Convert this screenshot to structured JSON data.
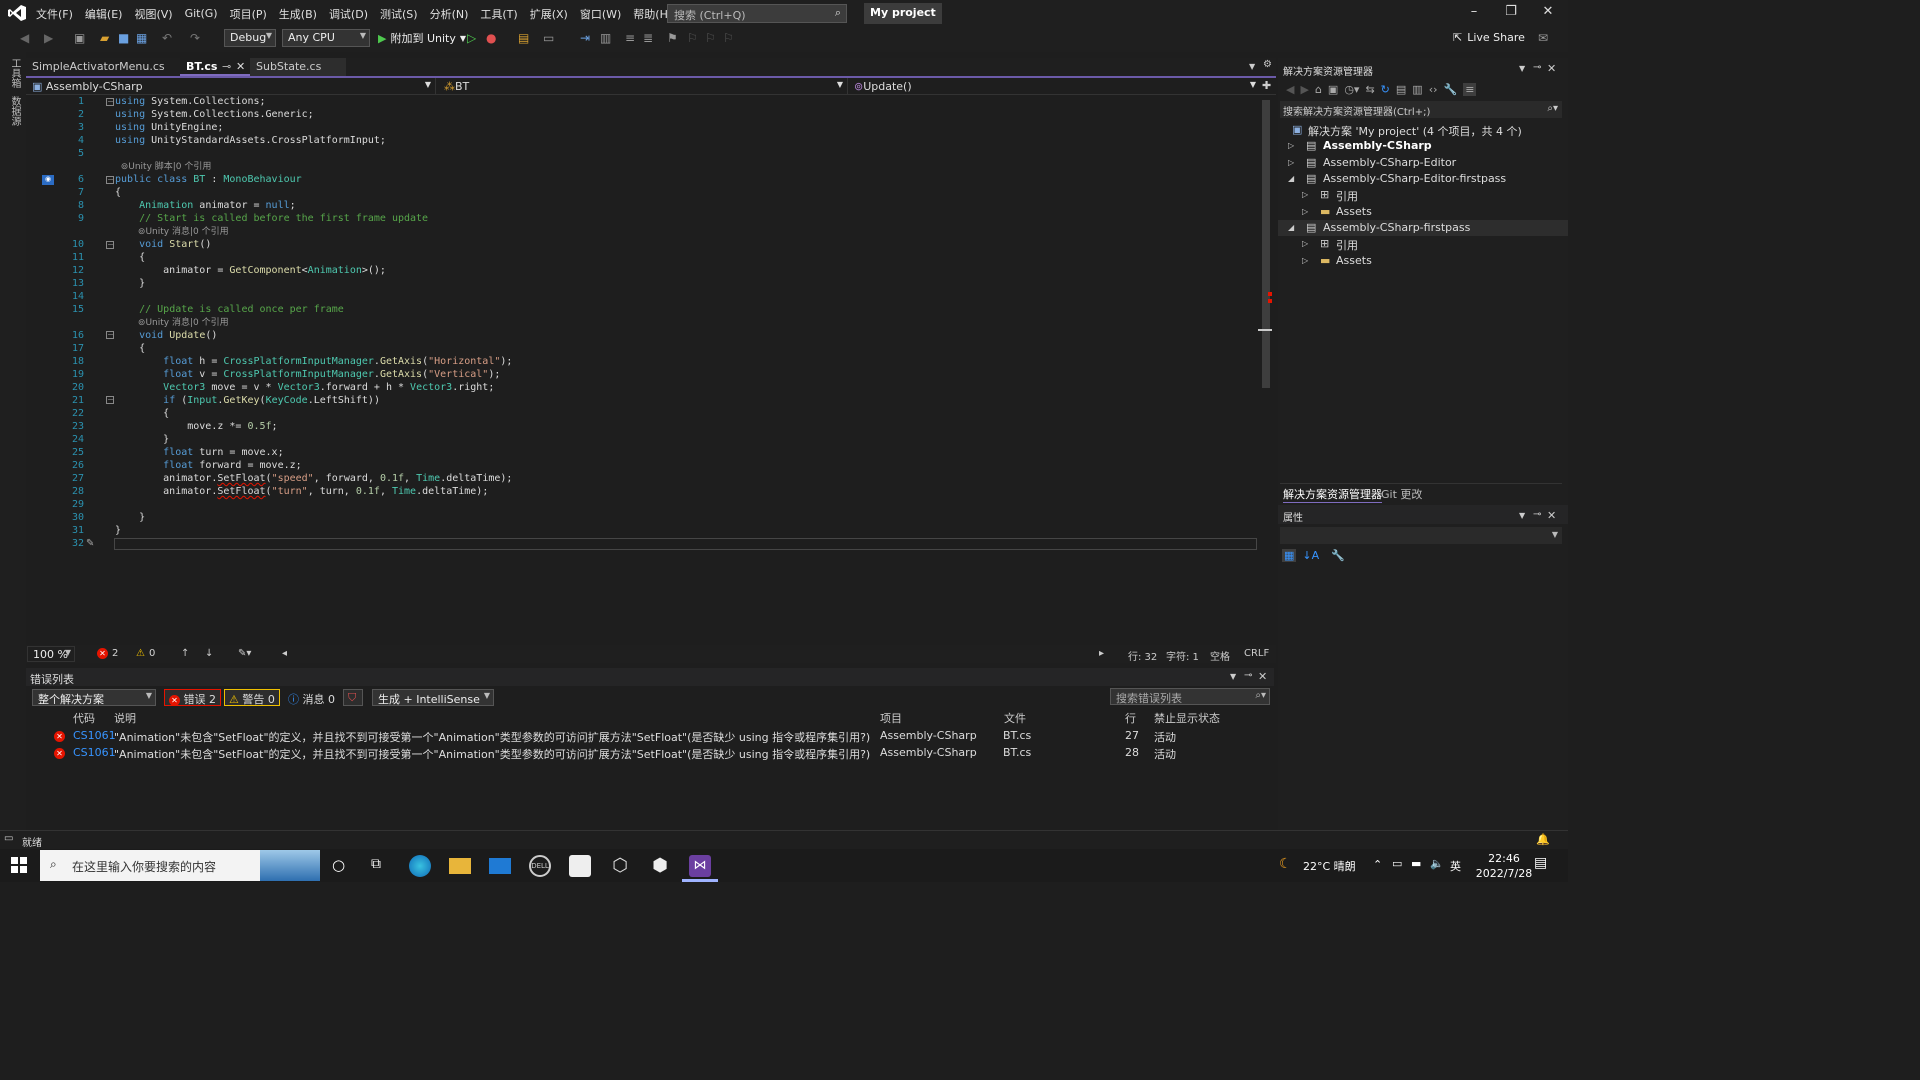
{
  "title_bar": {
    "menu": [
      "文件(F)",
      "编辑(E)",
      "视图(V)",
      "Git(G)",
      "项目(P)",
      "生成(B)",
      "调试(D)",
      "测试(S)",
      "分析(N)",
      "工具(T)",
      "扩展(X)",
      "窗口(W)",
      "帮助(H)"
    ],
    "search_placeholder": "搜索 (Ctrl+Q)",
    "project_name": "My project"
  },
  "toolbar": {
    "config": "Debug",
    "platform": "Any CPU",
    "attach_label": "附加到 Unity",
    "live_share": "Live Share"
  },
  "left_strip": {
    "label1": "工具箱",
    "label2": "数据源"
  },
  "tabs": [
    {
      "label": "SimpleActivatorMenu.cs"
    },
    {
      "label": "BT.cs"
    },
    {
      "label": "SubState.cs"
    }
  ],
  "nav": {
    "project": "Assembly-CSharp",
    "type": "BT",
    "member": "Update()"
  },
  "editor": {
    "line_numbers": [
      "1",
      "2",
      "3",
      "4",
      "5",
      "6",
      "7",
      "8",
      "9",
      "10",
      "11",
      "12",
      "13",
      "14",
      "15",
      "16",
      "17",
      "18",
      "19",
      "20",
      "21",
      "22",
      "23",
      "24",
      "25",
      "26",
      "27",
      "28",
      "29",
      "30",
      "31",
      "32"
    ],
    "hint_unity_script": "Unity 脚本|0 个引用",
    "hint_unity_msg": "Unity 消息|0 个引用"
  },
  "editor_status": {
    "zoom": "100 %",
    "errors": "2",
    "warnings": "0",
    "line": "行: 32",
    "char": "字符: 1",
    "space": "空格",
    "eol": "CRLF"
  },
  "error_list": {
    "title": "错误列表",
    "scope": "整个解决方案",
    "errors_btn": "错误 2",
    "warnings_btn": "警告 0",
    "messages_btn": "消息 0",
    "build_filter": "生成 + IntelliSense",
    "search_placeholder": "搜索错误列表",
    "columns": [
      "代码",
      "说明",
      "项目",
      "文件",
      "行",
      "禁止显示状态"
    ],
    "rows": [
      {
        "code": "CS1061",
        "desc": "\"Animation\"未包含\"SetFloat\"的定义，并且找不到可接受第一个\"Animation\"类型参数的可访问扩展方法\"SetFloat\"(是否缺少 using 指令或程序集引用?)",
        "project": "Assembly-CSharp",
        "file": "BT.cs",
        "line": "27",
        "state": "活动"
      },
      {
        "code": "CS1061",
        "desc": "\"Animation\"未包含\"SetFloat\"的定义，并且找不到可接受第一个\"Animation\"类型参数的可访问扩展方法\"SetFloat\"(是否缺少 using 指令或程序集引用?)",
        "project": "Assembly-CSharp",
        "file": "BT.cs",
        "line": "28",
        "state": "活动"
      }
    ]
  },
  "solution_explorer": {
    "title": "解决方案资源管理器",
    "search_placeholder": "搜索解决方案资源管理器(Ctrl+;)",
    "items": [
      {
        "label": "解决方案 'My project' (4 个项目，共 4 个)"
      },
      {
        "label": "Assembly-CSharp"
      },
      {
        "label": "Assembly-CSharp-Editor"
      },
      {
        "label": "Assembly-CSharp-Editor-firstpass"
      },
      {
        "label": "引用"
      },
      {
        "label": "Assets"
      },
      {
        "label": "Assembly-CSharp-firstpass"
      },
      {
        "label": "引用"
      },
      {
        "label": "Assets"
      }
    ],
    "tab_solution": "解决方案资源管理器",
    "tab_git": "Git 更改"
  },
  "properties": {
    "title": "属性"
  },
  "status_bar": {
    "text": "就绪"
  },
  "taskbar": {
    "search_placeholder": "在这里输入你要搜索的内容",
    "weather": "22°C 晴朗",
    "ime": "英",
    "time": "22:46",
    "date": "2022/7/28"
  },
  "colors": {
    "accent": "#7f6cc0",
    "error": "#e51400",
    "keyword": "#569cd6",
    "type": "#4ec9b0",
    "string": "#d69d85",
    "comment": "#57a64a"
  }
}
